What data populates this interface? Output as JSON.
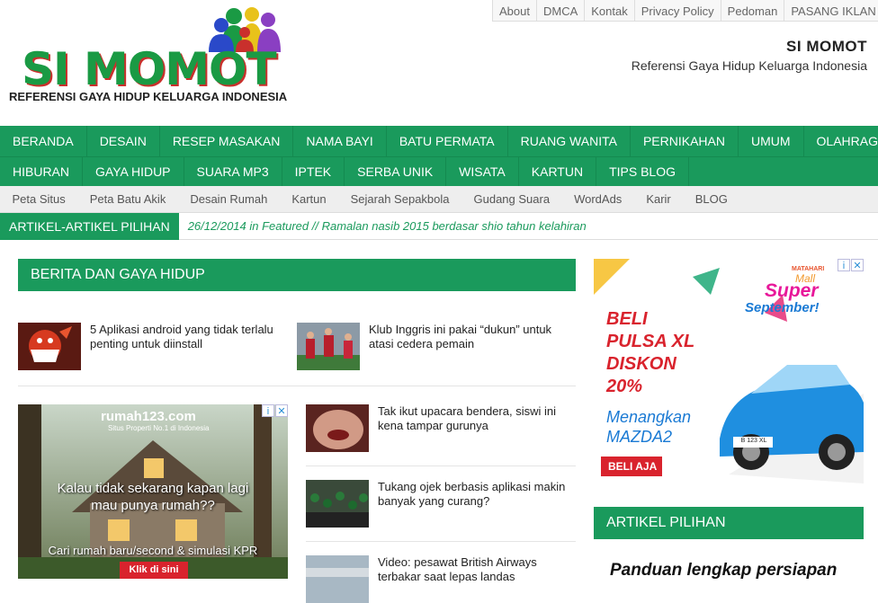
{
  "top_links": [
    "About",
    "DMCA",
    "Kontak",
    "Privacy Policy",
    "Pedoman",
    "PASANG IKLAN"
  ],
  "logo": {
    "text": "SI MOMOT",
    "tagline": "REFERENSI GAYA HIDUP KELUARGA INDONESIA"
  },
  "site": {
    "title": "SI MOMOT",
    "description": "Referensi Gaya Hidup Keluarga Indonesia"
  },
  "main_nav": {
    "row1": [
      "BERANDA",
      "DESAIN",
      "RESEP MASAKAN",
      "NAMA BAYI",
      "BATU PERMATA",
      "RUANG WANITA",
      "PERNIKAHAN",
      "UMUM",
      "OLAHRAGA"
    ],
    "row2": [
      "HIBURAN",
      "GAYA HIDUP",
      "SUARA MP3",
      "IPTEK",
      "SERBA UNIK",
      "WISATA",
      "KARTUN",
      "TIPS BLOG"
    ]
  },
  "sub_nav": [
    "Peta Situs",
    "Peta Batu Akik",
    "Desain Rumah",
    "Kartun",
    "Sejarah Sepakbola",
    "Gudang Suara",
    "WordAds",
    "Karir",
    "BLOG"
  ],
  "ticker": {
    "label": "ARTIKEL-ARTIKEL PILIHAN",
    "text": "26/12/2014 in Featured // Ramalan nasib 2015 berdasar shio tahun kelahiran"
  },
  "left_section": {
    "heading": "BERITA DAN GAYA HIDUP",
    "posts": [
      "5 Aplikasi android yang tidak terlalu penting untuk diinstall",
      "Klub Inggris ini pakai “dukun” untuk atasi cedera pemain",
      "Tak ikut upacara bendera, siswi ini kena tampar gurunya",
      "Tukang ojek berbasis aplikasi makin banyak yang curang?",
      "Video: pesawat British Airways terbakar saat lepas landas"
    ]
  },
  "ad_left": {
    "brand": "rumah123.com",
    "sub": "Situs Properti No.1 di Indonesia",
    "headline": "Kalau tidak sekarang kapan lagi mau punya rumah??",
    "line": "Cari rumah baru/second & simulasi KPR",
    "cta": "Klik di sini"
  },
  "ad_right": {
    "brand": "MATAHARI",
    "mall": "Mall",
    "super": "Super",
    "september": "September!",
    "headline1": "BELI",
    "headline2": "PULSA XL",
    "headline3": "DISKON",
    "headline4": "20%",
    "sub1": "Menangkan",
    "sub2": "MAZDA2",
    "cta": "BELI AJA",
    "plate": "B 123 XL"
  },
  "right_section": {
    "heading": "ARTIKEL PILIHAN",
    "article_title": "Panduan lengkap persiapan"
  },
  "colors": {
    "primary": "#1a9a5c",
    "logo_green": "#1a9a44",
    "logo_red": "#c9302c"
  }
}
